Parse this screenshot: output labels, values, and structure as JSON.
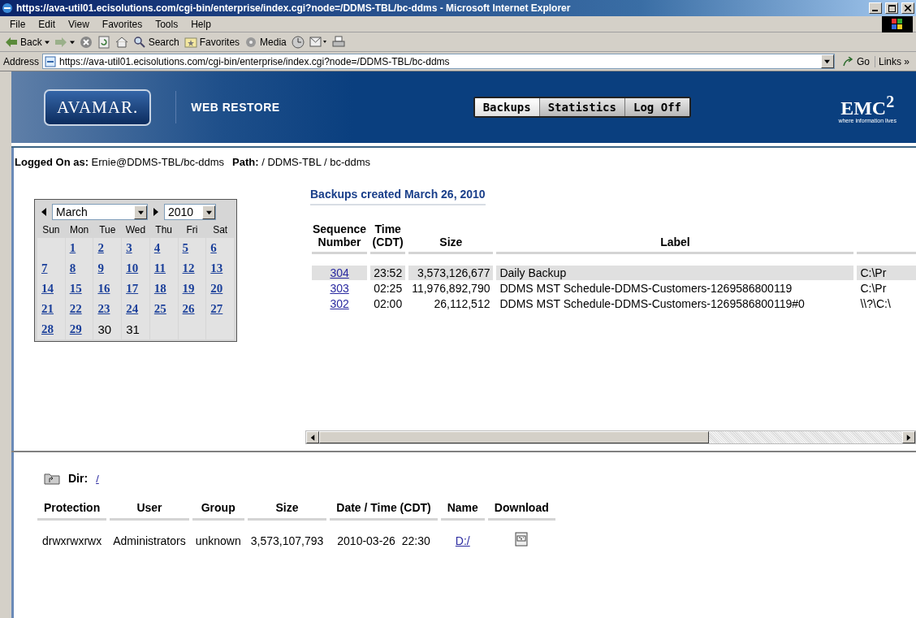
{
  "window": {
    "title": "https://ava-util01.ecisolutions.com/cgi-bin/enterprise/index.cgi?node=/DDMS-TBL/bc-ddms - Microsoft Internet Explorer"
  },
  "menu": [
    "File",
    "Edit",
    "View",
    "Favorites",
    "Tools",
    "Help"
  ],
  "toolbar": [
    {
      "kind": "back",
      "label": "Back"
    },
    {
      "kind": "forward"
    },
    {
      "kind": "stop"
    },
    {
      "kind": "refresh"
    },
    {
      "kind": "home"
    },
    {
      "kind": "search",
      "label": "Search"
    },
    {
      "kind": "favorites",
      "label": "Favorites"
    },
    {
      "kind": "media",
      "label": "Media"
    },
    {
      "kind": "history"
    },
    {
      "kind": "mail"
    },
    {
      "kind": "print"
    }
  ],
  "address_bar": {
    "label": "Address",
    "value": "https://ava-util01.ecisolutions.com/cgi-bin/enterprise/index.cgi?node=/DDMS-TBL/bc-ddms",
    "go": "Go",
    "links": "Links »"
  },
  "banner": {
    "logo": "AVAMAR.",
    "subtitle": "WEB RESTORE",
    "brand": "EMC$^{2}$",
    "tagline": "where information lives",
    "tabs": [
      {
        "label": "Backups",
        "selected": true
      },
      {
        "label": "Statistics",
        "selected": false
      },
      {
        "label": "Log Off",
        "selected": false
      }
    ]
  },
  "session": {
    "logged_on": "**Logged On as:** Ernie@DDMS-TBL/bc-ddms",
    "path": "**Path:** / DDMS-TBL / bc-ddms"
  },
  "calendar": {
    "month": "March",
    "year": "2010",
    "weekdays": [
      "Sun",
      "Mon",
      "Tue",
      "Wed",
      "Thu",
      "Fri",
      "Sat"
    ],
    "weeks": [
      [
        {
          "kind": "blank"
        },
        {
          "kind": "day",
          "day": "1",
          "linked": true
        },
        {
          "kind": "day",
          "day": "2",
          "linked": true
        },
        {
          "kind": "day",
          "day": "3",
          "linked": true
        },
        {
          "kind": "day",
          "day": "4",
          "linked": true
        },
        {
          "kind": "day",
          "day": "5",
          "linked": true
        },
        {
          "kind": "day",
          "day": "6",
          "linked": true
        }
      ],
      [
        {
          "kind": "day",
          "day": "7",
          "linked": true
        },
        {
          "kind": "day",
          "day": "8",
          "linked": true
        },
        {
          "kind": "day",
          "day": "9",
          "linked": true
        },
        {
          "kind": "day",
          "day": "10",
          "linked": true
        },
        {
          "kind": "day",
          "day": "11",
          "linked": true
        },
        {
          "kind": "day",
          "day": "12",
          "linked": true
        },
        {
          "kind": "day",
          "day": "13",
          "linked": true
        }
      ],
      [
        {
          "kind": "day",
          "day": "14",
          "linked": true
        },
        {
          "kind": "day",
          "day": "15",
          "linked": true
        },
        {
          "kind": "day",
          "day": "16",
          "linked": true
        },
        {
          "kind": "day",
          "day": "17",
          "linked": true
        },
        {
          "kind": "day",
          "day": "18",
          "linked": true
        },
        {
          "kind": "day",
          "day": "19",
          "linked": true
        },
        {
          "kind": "day",
          "day": "20",
          "linked": true
        }
      ],
      [
        {
          "kind": "day",
          "day": "21",
          "linked": true
        },
        {
          "kind": "day",
          "day": "22",
          "linked": true
        },
        {
          "kind": "day",
          "day": "23",
          "linked": true
        },
        {
          "kind": "day",
          "day": "24",
          "linked": true
        },
        {
          "kind": "day",
          "day": "25",
          "linked": true
        },
        {
          "kind": "day",
          "day": "26",
          "linked": true
        },
        {
          "kind": "day",
          "day": "27",
          "linked": true
        }
      ],
      [
        {
          "kind": "day",
          "day": "28",
          "linked": true
        },
        {
          "kind": "day",
          "day": "29",
          "linked": true
        },
        {
          "kind": "day",
          "day": "30",
          "linked": false
        },
        {
          "kind": "day",
          "day": "31",
          "linked": false
        },
        {
          "kind": "blank"
        },
        {
          "kind": "blank"
        },
        {
          "kind": "blank"
        }
      ]
    ]
  },
  "backups": {
    "heading": "Backups created March 26, 2010",
    "columns": [
      "Sequence Number",
      "Time (CDT)",
      "Size",
      "Label"
    ],
    "rows": [
      {
        "selected": true,
        "number": "304",
        "time": "23:52",
        "size": "3,573,126,677",
        "label": "Daily Backup",
        "column_5": "C:\\Pr"
      },
      {
        "selected": false,
        "number": "303",
        "time": "02:25",
        "size": "11,976,892,790",
        "label": "DDMS MST Schedule-DDMS-Customers-1269586800119",
        "column_5": "C:\\Pr"
      },
      {
        "selected": false,
        "number": "302",
        "time": "02:00",
        "size": "26,112,512",
        "label": "DDMS MST Schedule-DDMS-Customers-1269586800119#0",
        "column_5": "\\\\?\\C:\\"
      }
    ]
  },
  "directory": {
    "label": "Dir:",
    "path": "/",
    "columns": [
      "Protection",
      "User",
      "Group",
      "Size",
      "Date / Time (CDT)",
      "Name",
      "Download"
    ],
    "rows": [
      {
        "protection": "drwxrwxrwx",
        "user": "Administrators",
        "group": "unknown",
        "size": "3,573,107,793",
        "datetime": "2010-03-26  22:30",
        "name": "D:/"
      }
    ]
  }
}
